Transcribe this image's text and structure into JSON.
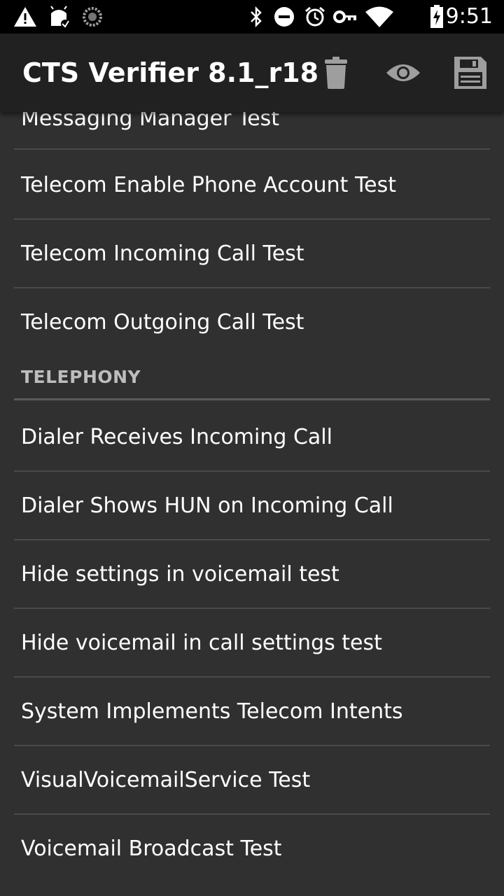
{
  "status_bar": {
    "time": "9:51",
    "left_icons": [
      "warning-icon",
      "android-debug-icon",
      "loading-spinner-icon"
    ],
    "right_icons": [
      "bluetooth-icon",
      "do-not-disturb-icon",
      "alarm-icon",
      "vpn-key-icon",
      "wifi-icon",
      "battery-charging-icon"
    ]
  },
  "app_bar": {
    "title": "CTS Verifier 8.1_r18",
    "actions": [
      "delete-icon",
      "eye-icon",
      "save-icon"
    ]
  },
  "list": {
    "partial_item": "Messaging Manager Test",
    "items_before": [
      "Telecom Enable Phone Account Test",
      "Telecom Incoming Call Test",
      "Telecom Outgoing Call Test"
    ],
    "section_header": "TELEPHONY",
    "items_after": [
      "Dialer Receives Incoming Call",
      "Dialer Shows HUN on Incoming Call",
      "Hide settings in voicemail test",
      "Hide voicemail in call settings test",
      "System Implements Telecom Intents",
      "VisualVoicemailService Test",
      "Voicemail Broadcast Test"
    ]
  },
  "colors": {
    "status_bar_bg": "#000000",
    "app_bar_bg": "#212121",
    "list_bg": "#303030",
    "divider": "#4a4a4a",
    "section_text": "#bdbdbd",
    "text": "#ffffff"
  }
}
